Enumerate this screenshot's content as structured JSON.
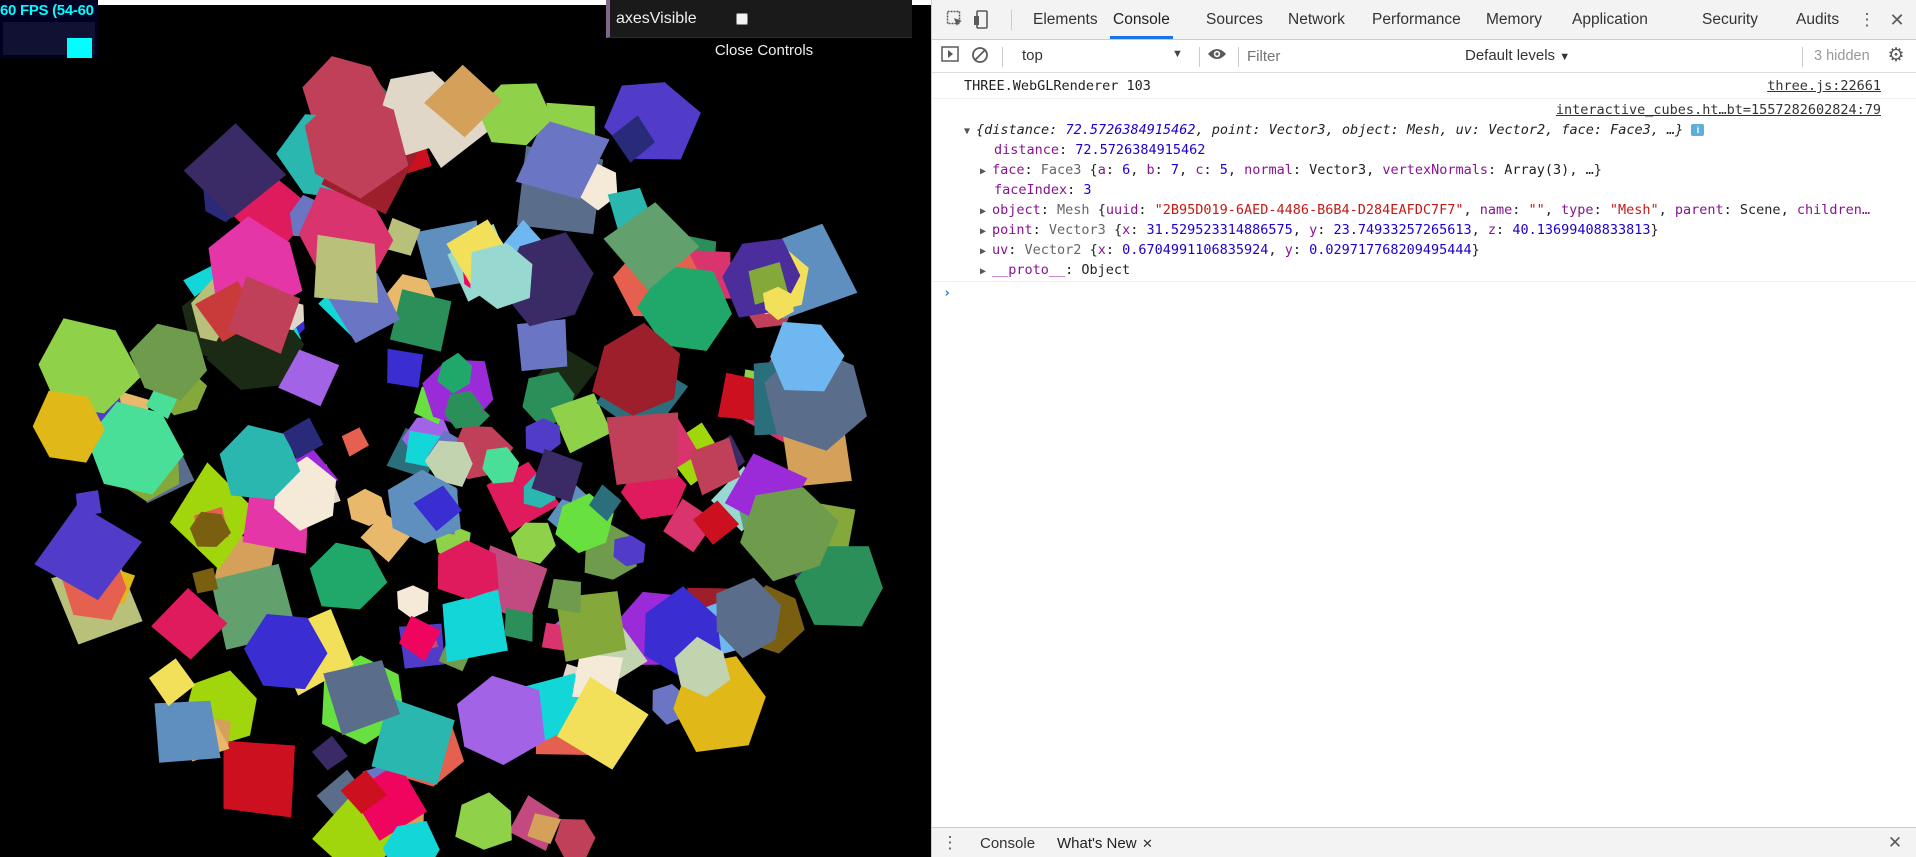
{
  "stats": {
    "fps_text": "60 FPS (54-60"
  },
  "gui": {
    "checkbox_label": "axesVisible",
    "checked": false,
    "close_label": "Close Controls"
  },
  "devtools": {
    "tabs": [
      "Elements",
      "Console",
      "Sources",
      "Network",
      "Performance",
      "Memory",
      "Application",
      "Security",
      "Audits"
    ],
    "active_tab": "Console",
    "context": "top",
    "filter_placeholder": "Filter",
    "levels": "Default levels",
    "hidden_count": "3 hidden",
    "messages": {
      "renderer": "THREE.WebGLRenderer 103",
      "renderer_src": "three.js:22661",
      "obj_src": "interactive_cubes.ht…bt=1557282602824:79",
      "summary": {
        "open": "{",
        "distance_key": "distance",
        "distance_val": "72.5726384915462",
        "point_key": "point",
        "point_type": "Vector3",
        "object_key": "object",
        "object_type": "Mesh",
        "uv_key": "uv",
        "uv_type": "Vector2",
        "face_key": "face",
        "face_type": "Face3",
        "tail": "…}"
      },
      "props": {
        "distance": {
          "key": "distance",
          "val": "72.5726384915462"
        },
        "face": {
          "key": "face",
          "type": "Face3",
          "a": "6",
          "b": "7",
          "c": "5",
          "normal": "Vector3",
          "vertexNormals": "Array(3)"
        },
        "faceIndex": {
          "key": "faceIndex",
          "val": "3"
        },
        "object": {
          "key": "object",
          "type": "Mesh",
          "uuid": "\"2B95D019-6AED-4486-B6B4-D284EAFDC7F7\"",
          "name": "\"\"",
          "obj_type": "\"Mesh\"",
          "parent": "Scene",
          "children_tail": "children…"
        },
        "point": {
          "key": "point",
          "type": "Vector3",
          "x": "31.529523314886575",
          "y": "23.74933257265613",
          "z": "40.13699408833813"
        },
        "uv": {
          "key": "uv",
          "type": "Vector2",
          "x": "0.6704991106835924",
          "y": "0.029717768209495444"
        },
        "proto": {
          "key": "__proto__",
          "val": "Object"
        }
      }
    },
    "drawer_tabs": [
      "Console",
      "What's New"
    ]
  }
}
